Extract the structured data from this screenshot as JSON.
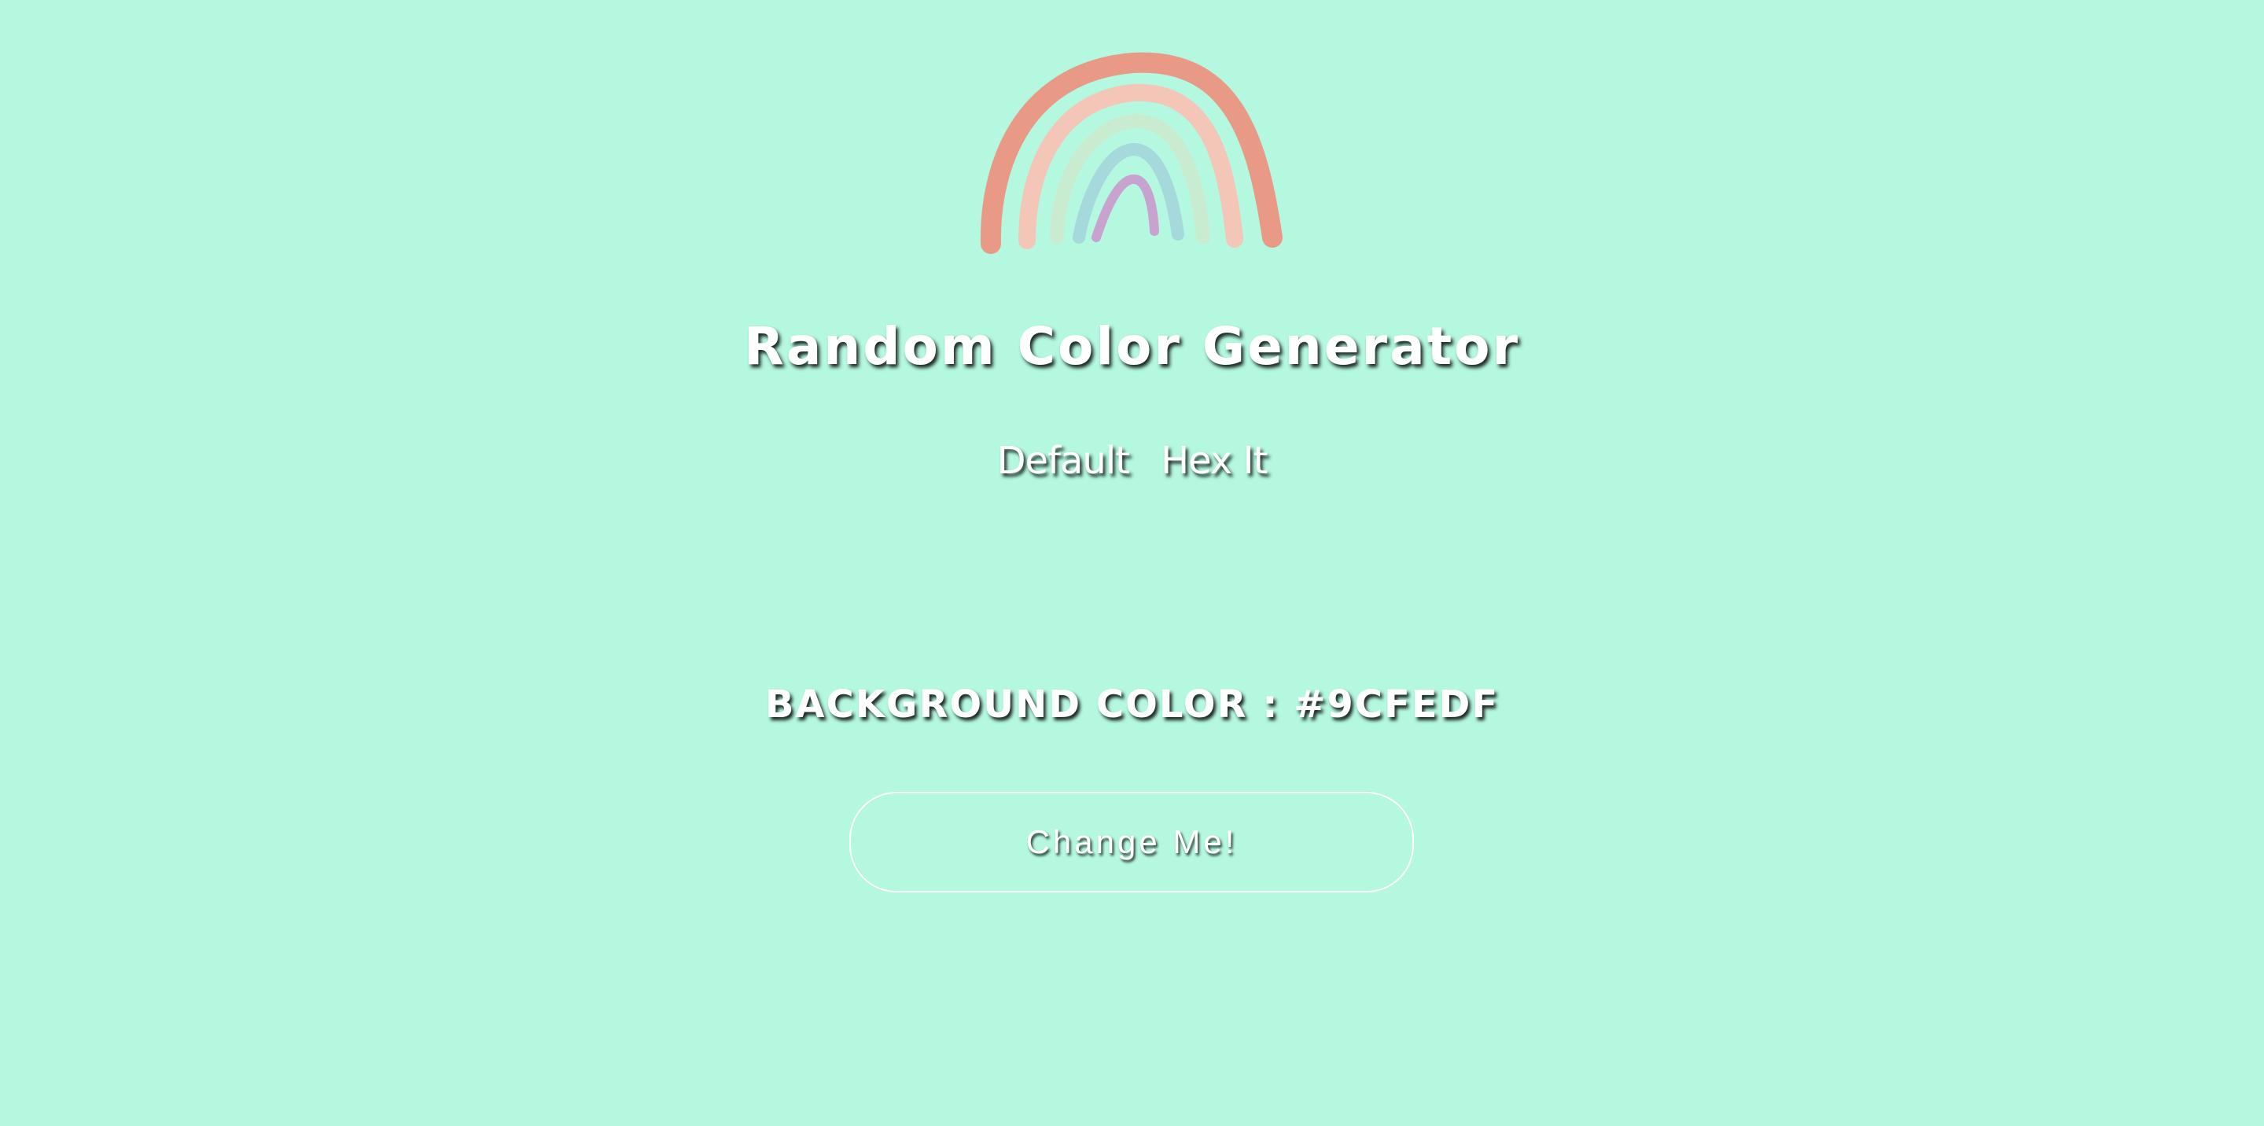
{
  "logo": {
    "icon": "rainbow-icon"
  },
  "title": "Random Color Generator",
  "nav": {
    "items": [
      {
        "label": "Default"
      },
      {
        "label": "Hex It"
      }
    ]
  },
  "color_readout": {
    "label": "BACKGROUND COLOR : #9CFEDF"
  },
  "change_button": {
    "label": "Change Me!"
  },
  "colors": {
    "background": "#b3f8df",
    "text": "#ffffff",
    "rainbow_outer": "#e99a87",
    "rainbow_2": "#f3c6b8",
    "rainbow_3": "#c9ecd0",
    "rainbow_4": "#a6d9dc",
    "rainbow_inner": "#c9a3cf"
  }
}
